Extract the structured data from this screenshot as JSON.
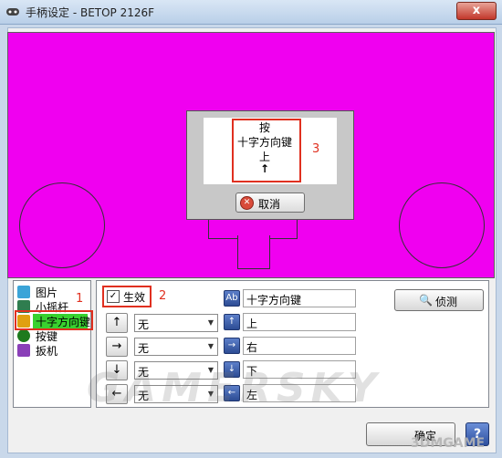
{
  "window": {
    "title": "手柄设定 - BETOP 2126F",
    "close_label": "x"
  },
  "popup": {
    "line1": "按",
    "line2": "十字方向键",
    "line3": "上",
    "line4": "↑",
    "annotation": "3",
    "cancel_label": "取消"
  },
  "tree": {
    "items": [
      {
        "label": "图片",
        "icon": "picture-icon"
      },
      {
        "label": "小摇杆",
        "icon": "stick-icon"
      },
      {
        "label": "十字方向键",
        "icon": "dpad-icon",
        "selected": true
      },
      {
        "label": "按键",
        "icon": "button-icon"
      },
      {
        "label": "扳机",
        "icon": "trigger-icon"
      }
    ],
    "annotation": "1"
  },
  "panel": {
    "enable_label": "生效",
    "enable_checked": "✓",
    "annotation": "2",
    "rows": [
      {
        "arrow": "↑",
        "combo": "无"
      },
      {
        "arrow": "→",
        "combo": "无"
      },
      {
        "arrow": "↓",
        "combo": "无"
      },
      {
        "arrow": "←",
        "combo": "无"
      }
    ],
    "key_name_icon": "Ab",
    "key_name": "十字方向键",
    "key_fields": [
      {
        "icon": "↑",
        "value": "上"
      },
      {
        "icon": "→",
        "value": "右"
      },
      {
        "icon": "↓",
        "value": "下"
      },
      {
        "icon": "←",
        "value": "左"
      }
    ],
    "detect_label": "侦测",
    "detect_icon": "🔍"
  },
  "footer": {
    "ok_label": "确定",
    "help_label": "?"
  },
  "watermarks": {
    "main": "GAMERSKY",
    "site": "3DMGAME"
  },
  "colors": {
    "stage": "#f000f0",
    "annotation_red": "#e03020",
    "tree_selected": "#39d12f"
  }
}
